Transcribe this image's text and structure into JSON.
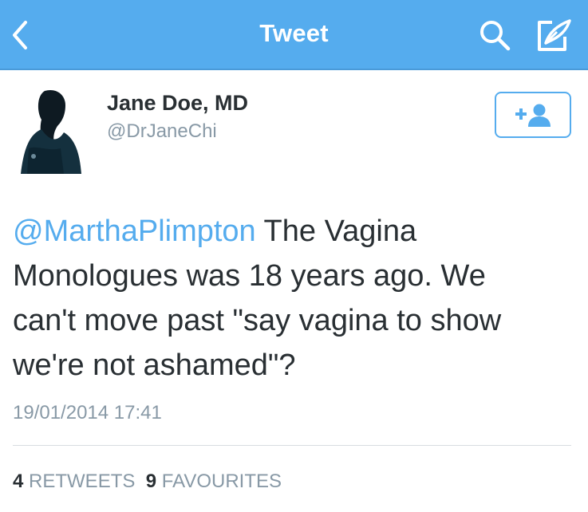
{
  "navbar": {
    "title": "Tweet",
    "background": "#55acee",
    "icons": [
      "back-chevron-icon",
      "search-icon",
      "compose-icon"
    ]
  },
  "user": {
    "name": "Jane Doe, MD",
    "handle": "@DrJaneChi",
    "avatar_icon": "silhouette-avatar"
  },
  "follow_button": {
    "icon": "follow-user-icon",
    "accent": "#55acee"
  },
  "tweet": {
    "mention": "@MarthaPlimpton",
    "line1_rest": " The Vagina",
    "line2": "Monologues was 18 years ago. We",
    "line3": "can't move past \"say vagina to show",
    "line4": "we're not ashamed\"?",
    "timestamp": "19/01/2014 17:41"
  },
  "stats": {
    "retweets_count": "4",
    "retweets_label": "RETWEETS",
    "favourites_count": "9",
    "favourites_label": "FAVOURITES"
  }
}
